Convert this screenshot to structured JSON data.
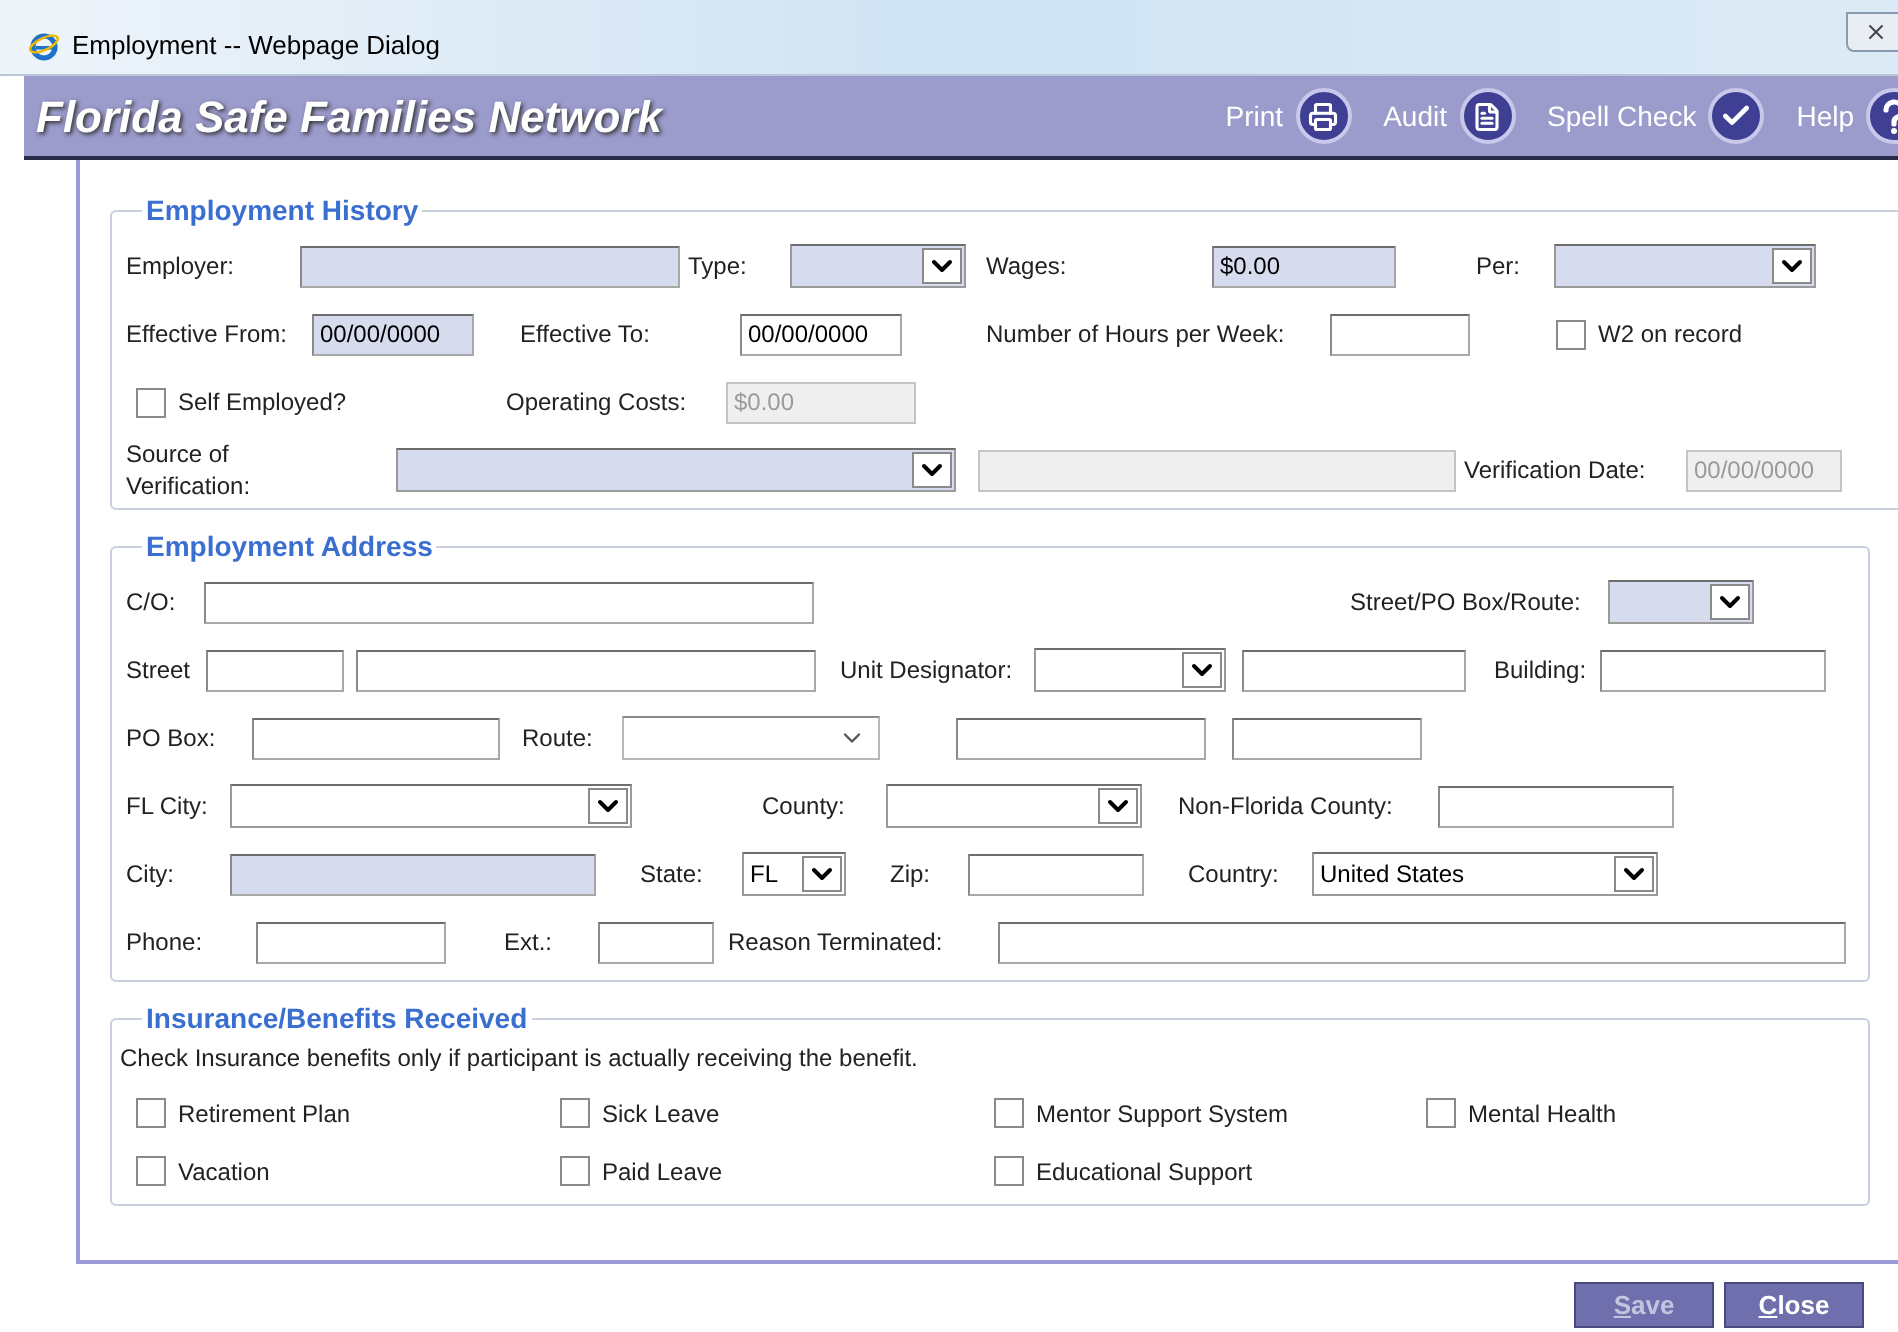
{
  "window": {
    "title": "Employment -- Webpage Dialog"
  },
  "header": {
    "title": "Florida Safe Families Network",
    "actions": [
      {
        "label": "Print",
        "kind": "print"
      },
      {
        "label": "Audit",
        "kind": "document"
      },
      {
        "label": "Spell Check",
        "kind": "spellcheck"
      },
      {
        "label": "Help",
        "kind": "help"
      }
    ]
  },
  "sections": [
    {
      "title": "Employment History",
      "items": [
        {
          "label": "Employer:",
          "fields": [
            {
              "kind": "input",
              "highlighted": true,
              "disabled": false
            }
          ]
        },
        {
          "label": "Type:",
          "fields": [
            {
              "kind": "select",
              "highlighted": true,
              "disabled": false
            }
          ]
        },
        {
          "label": "Wages:",
          "fields": [
            {
              "kind": "input",
              "value": "$0.00",
              "highlighted": true,
              "disabled": false
            }
          ]
        },
        {
          "label": "Per:",
          "fields": [
            {
              "kind": "select",
              "highlighted": true,
              "disabled": false
            }
          ]
        },
        {
          "label": "Effective From:",
          "fields": [
            {
              "kind": "input",
              "value": "00/00/0000",
              "highlighted": true,
              "disabled": false
            }
          ]
        },
        {
          "label": "Effective To:",
          "fields": [
            {
              "kind": "input",
              "value": "00/00/0000",
              "highlighted": false,
              "disabled": false
            }
          ]
        },
        {
          "label": "Number of Hours per Week:",
          "fields": [
            {
              "kind": "input",
              "highlighted": false,
              "disabled": false
            }
          ]
        },
        {
          "kind": "checkbox",
          "label": "W2 on record",
          "checked": false
        },
        {
          "kind": "checkbox",
          "label": "Self Employed?",
          "checked": false
        },
        {
          "label": "Operating Costs:",
          "fields": [
            {
              "kind": "input",
              "value": "$0.00",
              "highlighted": false,
              "disabled": true
            }
          ]
        },
        {
          "label": "Source of Verification:",
          "fields": [
            {
              "kind": "select",
              "highlighted": true,
              "disabled": false
            },
            {
              "kind": "input",
              "highlighted": false,
              "disabled": true
            }
          ]
        },
        {
          "label": "Verification Date:",
          "fields": [
            {
              "kind": "input",
              "value": "00/00/0000",
              "highlighted": false,
              "disabled": true
            }
          ]
        }
      ]
    },
    {
      "title": "Employment Address",
      "items": [
        {
          "label": "C/O:",
          "fields": [
            {
              "kind": "input",
              "highlighted": false,
              "disabled": false
            }
          ]
        },
        {
          "label": "Street/PO Box/Route:",
          "fields": [
            {
              "kind": "select",
              "highlighted": true,
              "disabled": false
            }
          ]
        },
        {
          "label": "Street",
          "fields": [
            {
              "kind": "input",
              "highlighted": false,
              "disabled": false
            },
            {
              "kind": "input",
              "highlighted": false,
              "disabled": false
            }
          ]
        },
        {
          "label": "Unit Designator:",
          "fields": [
            {
              "kind": "select",
              "highlighted": false,
              "disabled": false
            },
            {
              "kind": "input",
              "highlighted": false,
              "disabled": false
            }
          ]
        },
        {
          "label": "Building:",
          "fields": [
            {
              "kind": "input",
              "highlighted": false,
              "disabled": false
            }
          ]
        },
        {
          "label": "PO Box:",
          "fields": [
            {
              "kind": "input",
              "highlighted": false,
              "disabled": false
            }
          ]
        },
        {
          "label": "Route:",
          "fields": [
            {
              "kind": "combo",
              "highlighted": false,
              "disabled": false
            },
            {
              "kind": "input",
              "highlighted": false,
              "disabled": false
            },
            {
              "kind": "input",
              "highlighted": false,
              "disabled": false
            }
          ]
        },
        {
          "label": "FL City:",
          "fields": [
            {
              "kind": "select",
              "highlighted": false,
              "disabled": false
            }
          ]
        },
        {
          "label": "County:",
          "fields": [
            {
              "kind": "select",
              "highlighted": false,
              "disabled": false
            }
          ]
        },
        {
          "label": "Non-Florida County:",
          "fields": [
            {
              "kind": "input",
              "highlighted": false,
              "disabled": false
            }
          ]
        },
        {
          "label": "City:",
          "fields": [
            {
              "kind": "input",
              "highlighted": true,
              "disabled": false
            }
          ]
        },
        {
          "label": "State:",
          "fields": [
            {
              "kind": "select",
              "value": "FL",
              "highlighted": false,
              "disabled": false
            }
          ]
        },
        {
          "label": "Zip:",
          "fields": [
            {
              "kind": "input",
              "highlighted": false,
              "disabled": false
            }
          ]
        },
        {
          "label": "Country:",
          "fields": [
            {
              "kind": "select",
              "value": "United States",
              "highlighted": false,
              "disabled": false
            }
          ]
        },
        {
          "label": "Phone:",
          "fields": [
            {
              "kind": "input",
              "highlighted": false,
              "disabled": false
            }
          ]
        },
        {
          "label": "Ext.:",
          "fields": [
            {
              "kind": "input",
              "highlighted": false,
              "disabled": false
            }
          ]
        },
        {
          "label": "Reason Terminated:",
          "fields": [
            {
              "kind": "input",
              "highlighted": false,
              "disabled": false
            }
          ]
        }
      ]
    },
    {
      "title": "Insurance/Benefits Received",
      "note": "Check Insurance benefits only if participant is actually receiving the benefit.",
      "items": [
        {
          "kind": "checkbox",
          "label": "Retirement Plan",
          "checked": false
        },
        {
          "kind": "checkbox",
          "label": "Sick Leave",
          "checked": false
        },
        {
          "kind": "checkbox",
          "label": "Mentor Support System",
          "checked": false
        },
        {
          "kind": "checkbox",
          "label": "Mental Health",
          "checked": false
        },
        {
          "kind": "checkbox",
          "label": "Vacation",
          "checked": false
        },
        {
          "kind": "checkbox",
          "label": "Paid Leave",
          "checked": false
        },
        {
          "kind": "checkbox",
          "label": "Educational Support",
          "checked": false
        }
      ]
    }
  ],
  "buttons": [
    {
      "label": "Save",
      "disabled": true
    },
    {
      "label": "Close",
      "disabled": false
    }
  ]
}
